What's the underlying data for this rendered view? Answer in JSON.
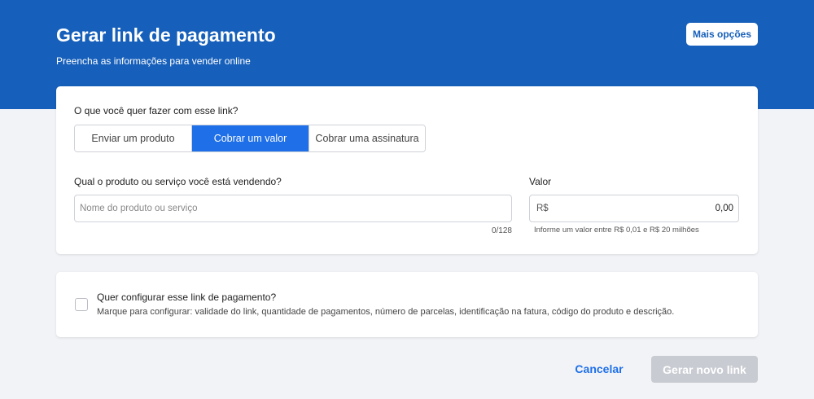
{
  "header": {
    "title": "Gerar link de pagamento",
    "subtitle": "Preencha as informações para vender online",
    "more_options_label": "Mais opções"
  },
  "link_type": {
    "question": "O que você quer fazer com esse link?",
    "options": [
      {
        "label": "Enviar um produto",
        "selected": false
      },
      {
        "label": "Cobrar um valor",
        "selected": true
      },
      {
        "label": "Cobrar uma assinatura",
        "selected": false
      }
    ]
  },
  "product": {
    "label": "Qual o produto ou serviço você está vendendo?",
    "placeholder": "Nome do produto ou serviço",
    "value": "",
    "counter": "0/128"
  },
  "amount": {
    "label": "Valor",
    "currency_prefix": "R$",
    "value": "0,00",
    "hint": "Informe um valor entre R$ 0,01 e R$ 20 milhões"
  },
  "config": {
    "checked": false,
    "title": "Quer configurar esse link de pagamento?",
    "description": "Marque para configurar: validade do link, quantidade de pagamentos, número de parcelas, identificação na fatura, código do produto e descrição."
  },
  "footer": {
    "cancel_label": "Cancelar",
    "generate_label": "Gerar novo link",
    "generate_disabled": true
  },
  "colors": {
    "header_bg": "#165fba",
    "accent": "#1e6fe8",
    "disabled": "#c8cbd1",
    "page_bg": "#f2f3f7"
  }
}
